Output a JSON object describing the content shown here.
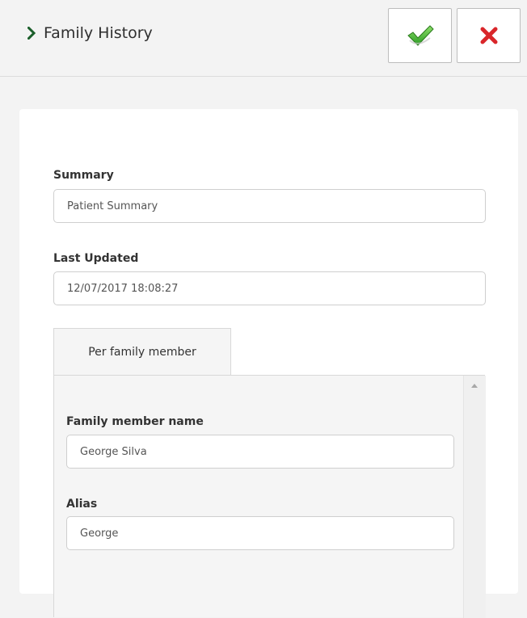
{
  "header": {
    "title": "Family History",
    "save_icon": "checkmark-icon",
    "cancel_icon": "close-icon"
  },
  "form": {
    "summary": {
      "label": "Summary",
      "value": "Patient Summary"
    },
    "last_updated": {
      "label": "Last Updated",
      "value": "12/07/2017 18:08:27"
    },
    "tabs": [
      {
        "label": "Per family member",
        "active": true
      }
    ],
    "family_member": {
      "name_label": "Family member name",
      "name_value": "George Silva",
      "alias_label": "Alias",
      "alias_value": "George"
    }
  },
  "colors": {
    "chevron": "#1a5e2a",
    "check": "#3cae2b",
    "cross": "#d9262a"
  }
}
